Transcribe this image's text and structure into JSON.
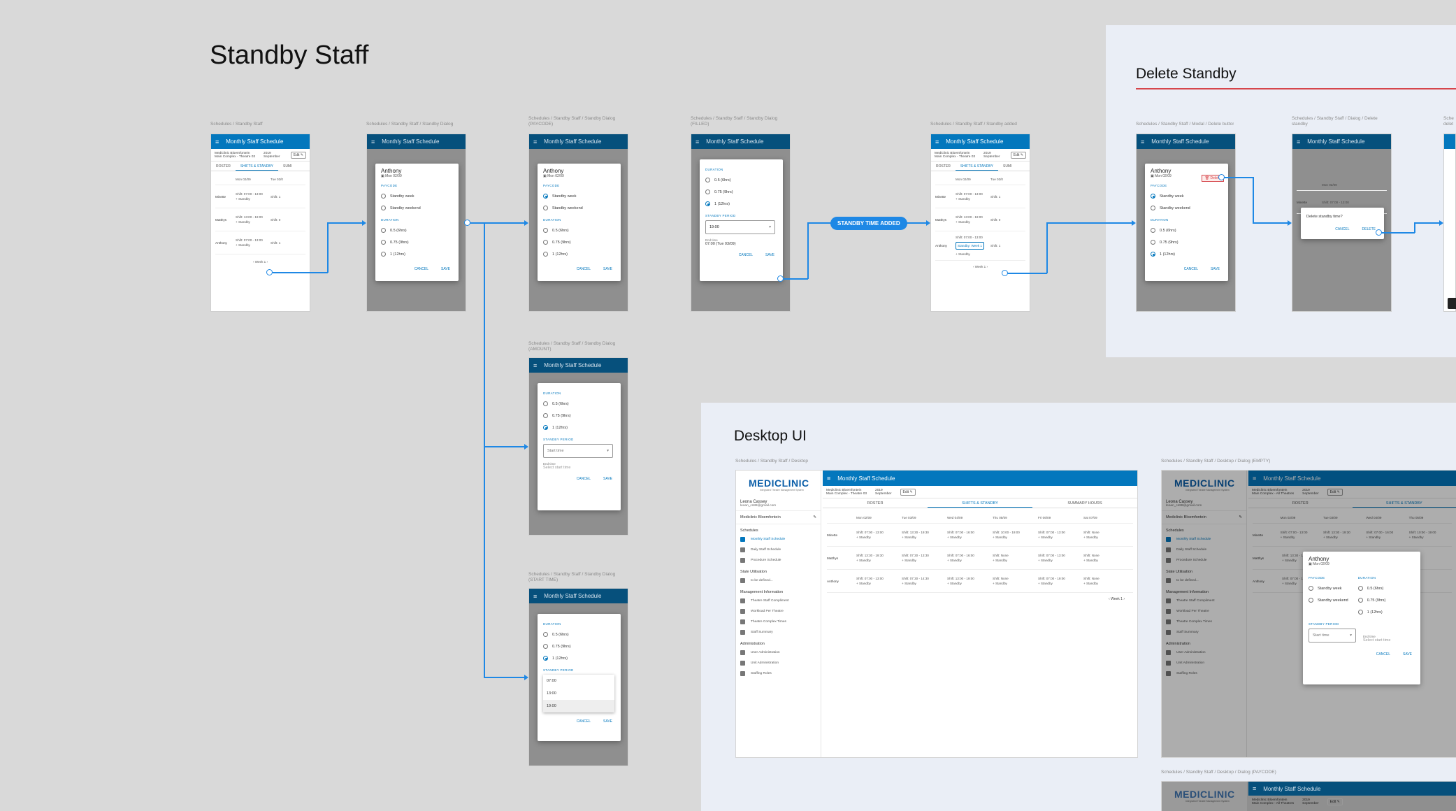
{
  "titles": {
    "main": "Standby Staff",
    "delete_section": "Delete Standby",
    "desktop_section": "Desktop UI"
  },
  "flow_pill": "STANDBY TIME ADDED",
  "frame_labels": {
    "f1": "Schedules / Standby Staff",
    "f2": "Schedules / Standby Staff / Standby Dialog",
    "f3": "Schedules / Standby Staff / Standby Dialog (PAYCODE)",
    "f4": "Schedules / Standby Staff / Standby Dialog (FILLED)",
    "f5": "Schedules / Standby Staff / Standby added",
    "f6": "Schedules / Standby Staff / Modal / Delete button",
    "f7": "Schedules / Standby Staff / Dialog / Delete standby",
    "f8": "Sche delet",
    "f9": "Schedules / Standby Staff / Standby Dialog (AMOUNT)",
    "f10": "Schedules / Standby Staff / Standby Dialog (START TIME)",
    "d1": "Schedules / Standby Staff / Desktop",
    "d2": "Schedules / Standby Staff / Desktop / Dialog (EMPTY)",
    "d3": "Schedules / Standby Staff / Desktop / Dialog (PAYCODE)"
  },
  "app": {
    "title": "Monthly Staff Schedule",
    "location": "Mediclinic Bloemfontein",
    "theatre": "Main Complex - Theatre 03",
    "theatre_all": "Main Complex - All Theatres",
    "year": "2019",
    "month": "September",
    "edit": "Edit",
    "tabs": [
      "ROSTER",
      "SHIFTS & STANDBY",
      "SUMMARY HOURS"
    ],
    "tab_short": "SUMI"
  },
  "mobile_grid": {
    "dates": [
      "Mon 02/09",
      "Tue 03/0"
    ],
    "rows": [
      {
        "name": "Minette",
        "shift": "Shift: 07:00 - 13:00",
        "shift2": "Shift: 1",
        "standby": "Standby"
      },
      {
        "name": "Matthys",
        "shift": "Shift: 13:00 - 19:00",
        "shift2": "Shift: 0",
        "standby": "Standby"
      },
      {
        "name": "Anthony",
        "shift": "Shift: 07:00 - 13:00",
        "shift2": "Shift: 1",
        "standby": "Standby"
      }
    ],
    "week": "Week 1",
    "standby_chip": "Standby: Week 1"
  },
  "dialog": {
    "name": "Anthony",
    "date": "Mon 02/09",
    "paycode_label": "PAYCODE",
    "paycodes": [
      "Standby week",
      "Standby weekend"
    ],
    "duration_label": "DURATION",
    "durations": [
      "0.5 (6hrs)",
      "0.75 (9hrs)",
      "1 (12hrs)"
    ],
    "period_label": "STANDBY PERIOD",
    "start_label": "Start time",
    "start_value": "19:00",
    "end_label": "End time",
    "end_value": "07:00 (Tue 03/09)",
    "end_placeholder": "Select start time",
    "start_options": [
      "07:00",
      "13:00",
      "19:00"
    ],
    "cancel": "CANCEL",
    "save": "SAVE",
    "delete": "Delete",
    "delete_question": "Delete standby time?",
    "delete_btn": "DELETE"
  },
  "desktop": {
    "logo": "MEDICLINIC",
    "logo_sub": "Integrated Theatre Management System",
    "user": "Leona Cassey",
    "email": "leoan_cs88@gmail.com",
    "hospital": "Mediclinic Bloemfontein",
    "sections": {
      "schedules": "Schedules",
      "slate": "Slate Utilisation",
      "mgmt": "Management Information",
      "admin": "Administration"
    },
    "schedule_items": [
      "Monthly Staff Schedule",
      "Daily Staff Schedule",
      "Procedure Schedule"
    ],
    "slate_items": [
      "to be defined..."
    ],
    "mgmt_items": [
      "Theatre Staff Compliment",
      "Workload Per Theatre",
      "Theatre Complex Times",
      "Staff Summary"
    ],
    "admin_items": [
      "User Administration",
      "Unit Administration",
      "Staffing Roles"
    ],
    "dates": [
      "Mon 02/09",
      "Tue 03/09",
      "Wed 04/09",
      "Thu 05/09",
      "Fri 06/09",
      "Sat 07/09"
    ],
    "rows": [
      {
        "name": "Minette",
        "shifts": [
          "Shift: 07:00 - 13:00",
          "Shift: 13:30 - 19:30",
          "Shift: 07:00 - 16:00",
          "Shift: 10:00 - 19:00",
          "Shift: 07:00 - 13:00",
          "Shift: None"
        ]
      },
      {
        "name": "Matthys",
        "shifts": [
          "Shift: 13:30 - 19:30",
          "Shift: 07:30 - 13:30",
          "Shift: 07:00 - 16:00",
          "Shift: None",
          "Shift: 07:00 - 13:00",
          "Shift: None"
        ]
      },
      {
        "name": "Anthony",
        "shifts": [
          "Shift: 07:00 - 13:00",
          "Shift: 07:30 - 14:30",
          "Shift: 13:00 - 19:00",
          "Shift: None",
          "Shift: 07:00 - 19:00",
          "Shift: None"
        ]
      }
    ],
    "standby": "Standby",
    "week": "Week 1"
  },
  "colors": {
    "appbar": "#0377bd",
    "connector": "#1e88e5",
    "delete_underline": "#d6454b"
  }
}
